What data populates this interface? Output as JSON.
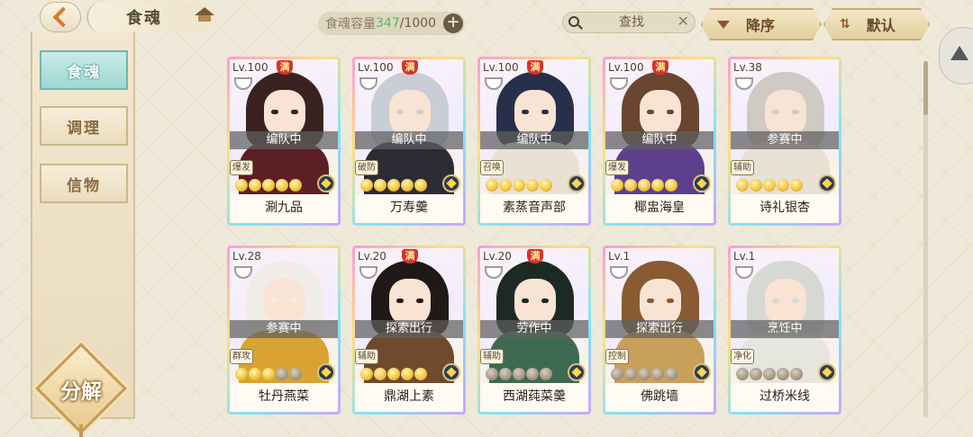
{
  "header": {
    "title": "食魂",
    "capacity_label": "食魂容量",
    "capacity_current": "347",
    "capacity_max": "/1000",
    "search_placeholder": "查找",
    "sort_label": "降序",
    "default_label": "默认"
  },
  "sidebar": {
    "tabs": [
      {
        "label": "食魂",
        "active": true
      },
      {
        "label": "调理",
        "active": false
      },
      {
        "label": "信物",
        "active": false
      }
    ],
    "decompose_label": "分解"
  },
  "cards": [
    {
      "level": "Lv.100",
      "full": true,
      "status": "编队中",
      "role": "爆发",
      "stars": 5,
      "name": "涮九品",
      "hair": "#3a2220",
      "robe": "#5c1f24"
    },
    {
      "level": "Lv.100",
      "full": true,
      "status": "编队中",
      "role": "破防",
      "stars": 5,
      "name": "万寿羹",
      "hair": "#c9cdd6",
      "robe": "#2c2c34"
    },
    {
      "level": "Lv.100",
      "full": true,
      "status": "编队中",
      "role": "召唤",
      "stars": 5,
      "name": "素蒸音声部",
      "hair": "#27304a",
      "robe": "#e9e2d4"
    },
    {
      "level": "Lv.100",
      "full": true,
      "status": "编队中",
      "role": "爆发",
      "stars": 5,
      "name": "椰盅海皇",
      "hair": "#6a4530",
      "robe": "#5d3f8e"
    },
    {
      "level": "Lv.38",
      "full": false,
      "status": "参赛中",
      "role": "辅助",
      "stars": 5,
      "name": "诗礼银杏",
      "hair": "#cfcac4",
      "robe": "#e7e1d6"
    },
    {
      "level": "Lv.28",
      "full": false,
      "status": "参赛中",
      "role": "群攻",
      "stars": 3,
      "name": "牡丹燕菜",
      "hair": "#f0ede8",
      "robe": "#d9a334"
    },
    {
      "level": "Lv.20",
      "full": true,
      "status": "探索出行",
      "role": "辅助",
      "stars": 5,
      "name": "鼎湖上素",
      "hair": "#1f1a17",
      "robe": "#6e4a2e"
    },
    {
      "level": "Lv.20",
      "full": true,
      "status": "劳作中",
      "role": "辅助",
      "stars": 0,
      "name": "西湖莼菜羹",
      "hair": "#1c2a24",
      "robe": "#3f6a52"
    },
    {
      "level": "Lv.1",
      "full": false,
      "status": "探索出行",
      "role": "控制",
      "stars": 0,
      "name": "佛跳墙",
      "hair": "#8a5a32",
      "robe": "#c9a05a"
    },
    {
      "level": "Lv.1",
      "full": false,
      "status": "烹饪中",
      "role": "净化",
      "stars": 0,
      "name": "过桥米线",
      "hair": "#d6d9d3",
      "robe": "#e6e6df"
    }
  ]
}
